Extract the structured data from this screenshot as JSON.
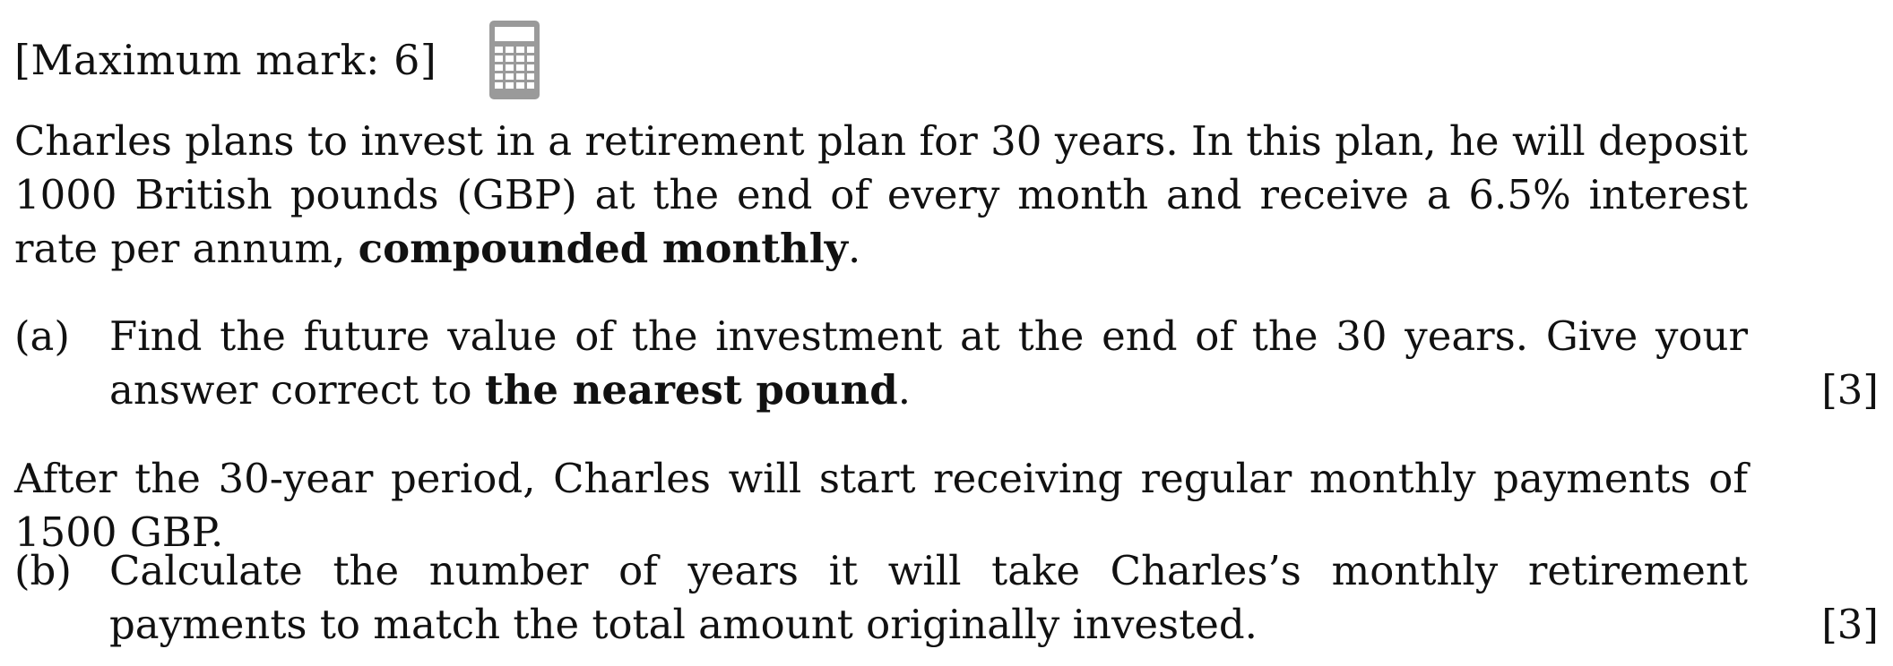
{
  "header": {
    "max_mark": "[Maximum mark: 6]",
    "calculator_icon": "calculator-icon"
  },
  "intro": {
    "part1": "Charles plans to invest in a retirement plan for 30 years.  In this plan, he will deposit 1000 British pounds (GBP) at the end of every month and receive a 6.5% interest rate per annum, ",
    "bold": "compounded monthly",
    "end": "."
  },
  "question_a": {
    "label": "(a)",
    "text1": "Find the future value of the investment at the end of the 30 years. Give your answer correct to ",
    "bold": "the nearest pound",
    "end": ".",
    "marks": "[3]"
  },
  "middle": {
    "text": "After the 30-year period, Charles will start receiving regular monthly payments of 1500 GBP."
  },
  "question_b": {
    "label": "(b)",
    "text": "Calculate the number of years it will take Charles’s monthly retirement payments to match the total amount originally invested.",
    "marks": "[3]"
  },
  "colors": {
    "text": "#111111",
    "icon": "#9a9a9a"
  }
}
